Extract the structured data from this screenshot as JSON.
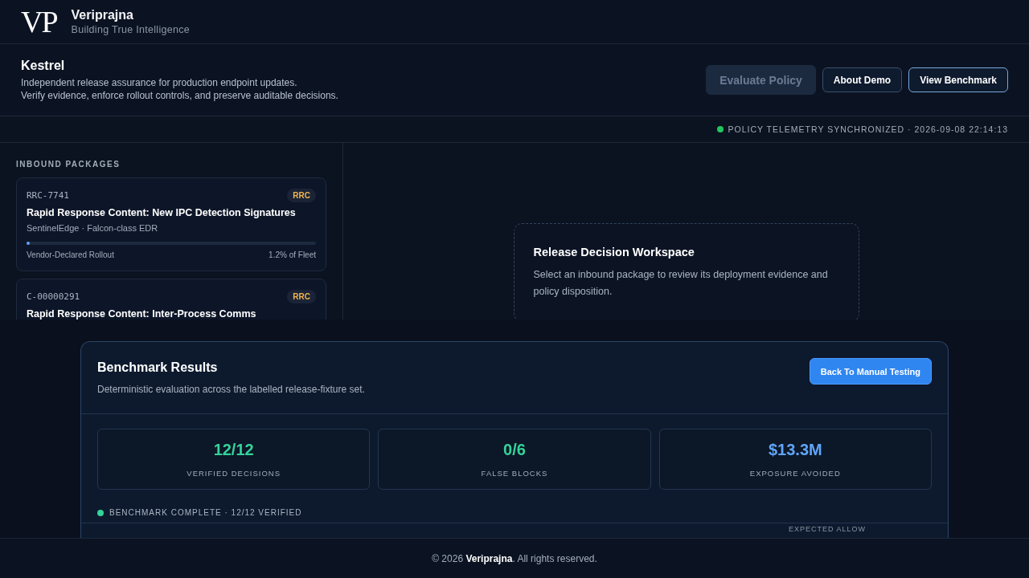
{
  "brand": {
    "logo_mark": "VP",
    "name": "Veriprajna",
    "tagline": "Building True Intelligence"
  },
  "product": {
    "title": "Kestrel",
    "description_lines": [
      "Independent release assurance for production endpoint updates.",
      "Verify evidence, enforce rollout controls, and preserve auditable decisions."
    ],
    "buttons": [
      {
        "label": "Evaluate Policy",
        "disabled": true,
        "selected": false
      },
      {
        "label": "About Demo",
        "disabled": false,
        "selected": false
      },
      {
        "label": "View Benchmark",
        "disabled": false,
        "selected": true
      }
    ]
  },
  "status_bar": {
    "text": "POLICY TELEMETRY SYNCHRONIZED · 2026-09-08 22:14:13",
    "color": "#22c55e"
  },
  "packages": {
    "heading": "INBOUND PACKAGES",
    "items": [
      {
        "id": "RRC-7741",
        "badge": "RRC",
        "title": "Rapid Response Content: New IPC Detection Signatures",
        "vendor": "SentinelEdge · Falcon-class EDR",
        "rollout_label": "Vendor-Declared Rollout",
        "rollout_value": "1.2% of Fleet",
        "level": 0.012
      },
      {
        "id": "C-00000291",
        "badge": "RRC",
        "title": "Rapid Response Content: Inter-Process Comms"
      }
    ]
  },
  "workspace": {
    "title": "Release Decision Workspace",
    "text": "Select an inbound package to review its deployment evidence and policy disposition."
  },
  "benchmark": {
    "title": "Benchmark Results",
    "subtitle": "Deterministic evaluation across the labelled release-fixture set.",
    "button": "Back To Manual Testing",
    "stats": [
      {
        "value": "12/12",
        "label": "VERIFIED DECISIONS",
        "color": "#34d399"
      },
      {
        "value": "0/6",
        "label": "FALSE BLOCKS",
        "color": "#34d399"
      },
      {
        "value": "$13.3M",
        "label": "EXPOSURE AVOIDED",
        "color": "#60a5fa"
      }
    ],
    "status": {
      "text": "BENCHMARK COMPLETE · 12/12 VERIFIED",
      "color": "#34d399"
    },
    "column_3": "EXPECTED ALLOW"
  },
  "footer": "© 2026 **Veriprajna**. All rights reserved."
}
